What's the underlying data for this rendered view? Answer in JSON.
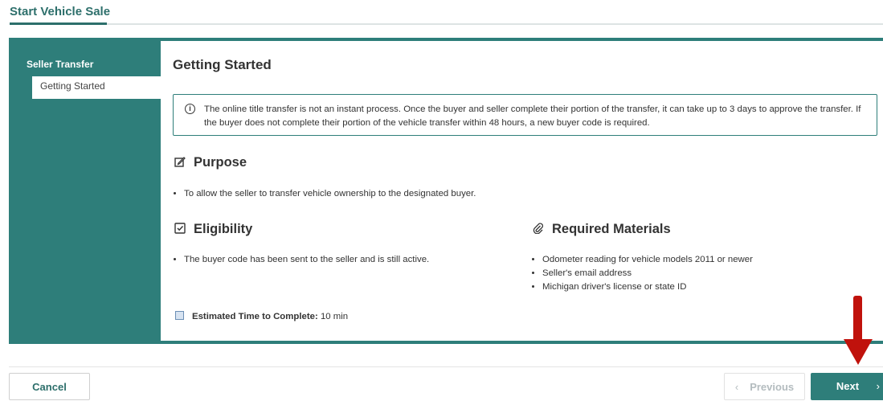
{
  "header": {
    "title": "Start Vehicle Sale"
  },
  "sidebar": {
    "heading": "Seller Transfer",
    "items": [
      {
        "label": "Getting Started"
      }
    ]
  },
  "content": {
    "title": "Getting Started",
    "info_text": "The online title transfer is not an instant process. Once the buyer and seller complete their portion of the transfer, it can take up to 3 days to approve the transfer. If the buyer does not complete their portion of the vehicle transfer within 48 hours, a new buyer code is required.",
    "purpose": {
      "heading": "Purpose",
      "items": [
        "To allow the seller to transfer vehicle ownership to the designated buyer."
      ]
    },
    "eligibility": {
      "heading": "Eligibility",
      "items": [
        "The buyer code has been sent to the seller and is still active."
      ]
    },
    "required_materials": {
      "heading": "Required Materials",
      "items": [
        "Odometer reading for vehicle models 2011 or newer",
        "Seller's email address",
        "Michigan driver's license or state ID"
      ]
    },
    "estimated_time": {
      "label": "Estimated Time to Complete:",
      "value": "10 min"
    }
  },
  "footer": {
    "cancel_label": "Cancel",
    "previous_label": "Previous",
    "next_label": "Next"
  },
  "icons": {
    "info": "info-circle-icon",
    "purpose": "edit-icon",
    "eligibility": "checkbox-icon",
    "materials": "paperclip-icon",
    "time": "calendar-icon",
    "previous": "chevron-left-icon",
    "next": "chevron-right-icon"
  },
  "colors": {
    "accent": "#2e7e7a",
    "title": "#2d6f6b",
    "annotation_arrow": "#c0120c"
  }
}
